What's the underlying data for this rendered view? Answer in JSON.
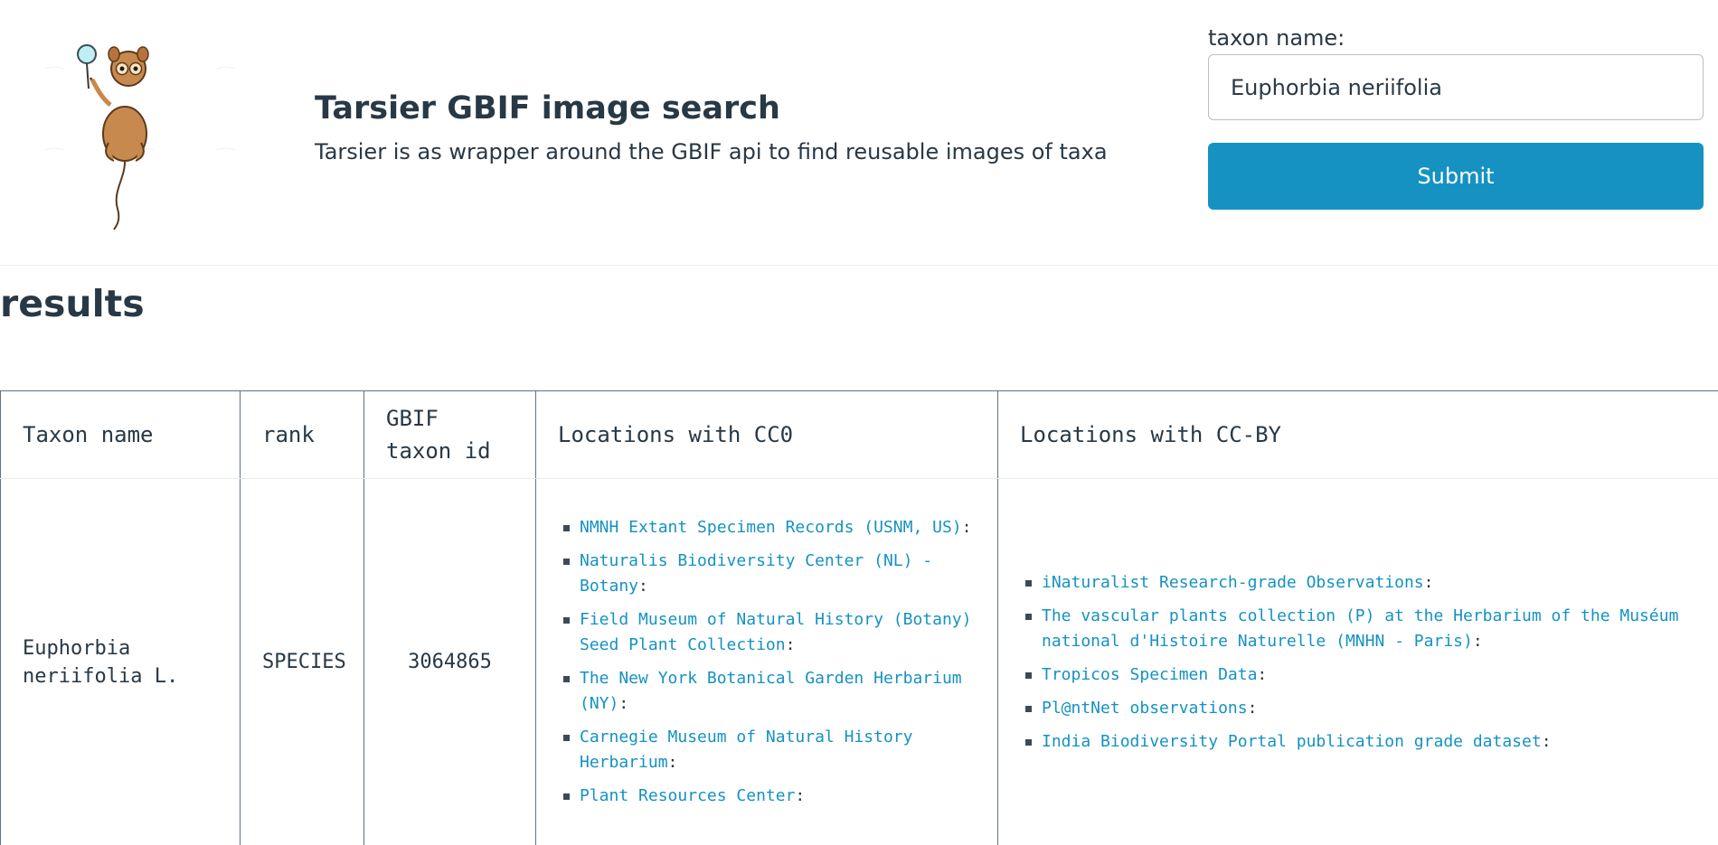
{
  "header": {
    "title": "Tarsier GBIF image search",
    "subtitle": "Tarsier is as wrapper around the GBIF api to find reusable images of taxa"
  },
  "search": {
    "label": "taxon name:",
    "value": "Euphorbia neriifolia",
    "submit_label": "Submit"
  },
  "results": {
    "heading": "results",
    "columns": [
      "Taxon name",
      "rank",
      "GBIF taxon id",
      "Locations with CC0",
      "Locations with CC-BY"
    ],
    "rows": [
      {
        "taxon_name": "Euphorbia neriifolia L.",
        "rank": "SPECIES",
        "gbif_id": "3064865",
        "cc0": [
          "NMNH Extant Specimen Records (USNM, US)",
          "Naturalis Biodiversity Center (NL) - Botany",
          "Field Museum of Natural History (Botany) Seed Plant Collection",
          "The New York Botanical Garden Herbarium (NY)",
          "Carnegie Museum of Natural History Herbarium",
          "Plant Resources Center"
        ],
        "ccby": [
          "iNaturalist Research-grade Observations",
          "The vascular plants collection (P) at the Herbarium of the Muséum national d'Histoire Naturelle (MNHN - Paris)",
          "Tropicos Specimen Data",
          "Pl@ntNet observations",
          "India Biodiversity Portal publication grade dataset"
        ]
      }
    ]
  },
  "colors": {
    "text": "#283845",
    "accent": "#1592c2",
    "table_border": "#5f7382"
  },
  "icons": {
    "logo": "tarsier-logo-icon",
    "bullet": "square-bullet-icon"
  }
}
